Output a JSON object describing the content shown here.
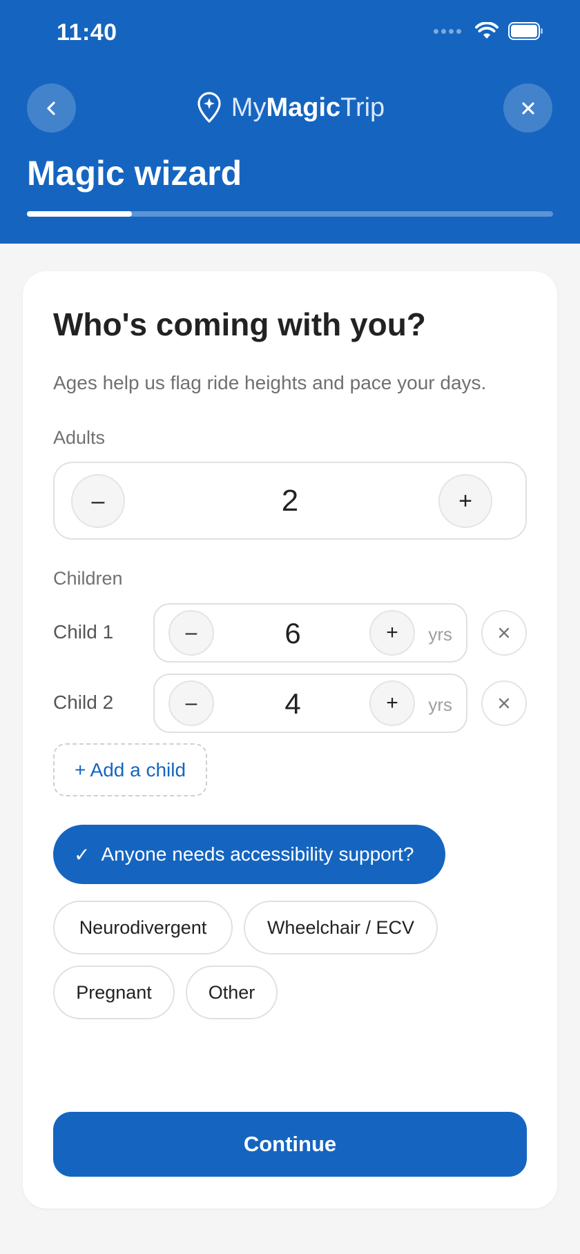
{
  "status_bar": {
    "time": "11:40"
  },
  "header": {
    "logo_my": "My",
    "logo_magic": "Magic",
    "logo_trip": "Trip",
    "title": "Magic wizard",
    "progress_percent": 20
  },
  "question": {
    "title": "Who's coming with you?",
    "subtitle": "Ages help us flag ride heights and pace your days."
  },
  "adults": {
    "label": "Adults",
    "count": "2",
    "minus": "–",
    "plus": "+"
  },
  "children": {
    "label": "Children",
    "items": [
      {
        "label": "Child 1",
        "age": "6",
        "unit": "yrs"
      },
      {
        "label": "Child 2",
        "age": "4",
        "unit": "yrs"
      }
    ],
    "minus": "–",
    "plus": "+",
    "add_label": "+ Add a child"
  },
  "accessibility": {
    "toggle_label": "Anyone needs accessibility support?",
    "checkmark": "✓",
    "options": [
      "Neurodivergent",
      "Wheelchair / ECV",
      "Pregnant",
      "Other"
    ]
  },
  "continue_label": "Continue",
  "colors": {
    "brand": "#1565c0",
    "background": "#f5f5f5"
  }
}
